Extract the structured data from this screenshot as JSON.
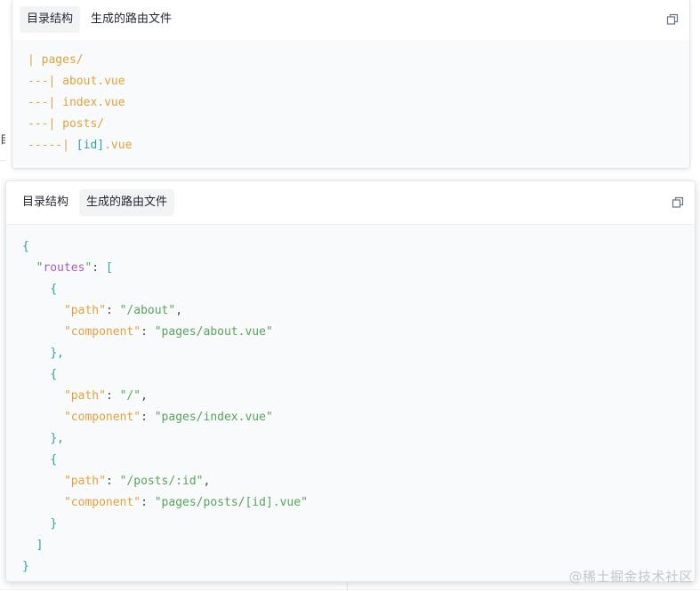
{
  "card1": {
    "tabs": [
      "目录结构",
      "生成的路由文件"
    ],
    "active_tab": 0,
    "copy_icon": "copy-icon",
    "code_lines": [
      [
        {
          "t": "| pages/",
          "c": "orange"
        }
      ],
      [
        {
          "t": "---| about.vue",
          "c": "orange"
        }
      ],
      [
        {
          "t": "---| index.vue",
          "c": "orange"
        }
      ],
      [
        {
          "t": "---| posts/",
          "c": "orange"
        }
      ],
      [
        {
          "t": "-----| ",
          "c": "orange"
        },
        {
          "t": "[id]",
          "c": "teal"
        },
        {
          "t": ".vue",
          "c": "orange"
        }
      ]
    ]
  },
  "card2": {
    "tabs": [
      "目录结构",
      "生成的路由文件"
    ],
    "active_tab": 1,
    "copy_icon": "copy-icon",
    "code_lines": [
      [
        {
          "t": "{",
          "c": "teal"
        }
      ],
      [
        {
          "t": "  ",
          "c": "dark"
        },
        {
          "t": "\"",
          "c": "green"
        },
        {
          "t": "routes",
          "c": "purple"
        },
        {
          "t": "\"",
          "c": "green"
        },
        {
          "t": ": ",
          "c": "dark"
        },
        {
          "t": "[",
          "c": "teal"
        }
      ],
      [
        {
          "t": "    ",
          "c": "dark"
        },
        {
          "t": "{",
          "c": "teal"
        }
      ],
      [
        {
          "t": "      ",
          "c": "dark"
        },
        {
          "t": "\"path\"",
          "c": "orange"
        },
        {
          "t": ": ",
          "c": "dark"
        },
        {
          "t": "\"/about\"",
          "c": "green"
        },
        {
          "t": ",",
          "c": "dark"
        }
      ],
      [
        {
          "t": "      ",
          "c": "dark"
        },
        {
          "t": "\"component\"",
          "c": "orange"
        },
        {
          "t": ": ",
          "c": "dark"
        },
        {
          "t": "\"pages/about.vue\"",
          "c": "green"
        }
      ],
      [
        {
          "t": "    ",
          "c": "dark"
        },
        {
          "t": "},",
          "c": "teal"
        }
      ],
      [
        {
          "t": "    ",
          "c": "dark"
        },
        {
          "t": "{",
          "c": "teal"
        }
      ],
      [
        {
          "t": "      ",
          "c": "dark"
        },
        {
          "t": "\"path\"",
          "c": "orange"
        },
        {
          "t": ": ",
          "c": "dark"
        },
        {
          "t": "\"/\"",
          "c": "green"
        },
        {
          "t": ",",
          "c": "dark"
        }
      ],
      [
        {
          "t": "      ",
          "c": "dark"
        },
        {
          "t": "\"component\"",
          "c": "orange"
        },
        {
          "t": ": ",
          "c": "dark"
        },
        {
          "t": "\"pages/index.vue\"",
          "c": "green"
        }
      ],
      [
        {
          "t": "    ",
          "c": "dark"
        },
        {
          "t": "},",
          "c": "teal"
        }
      ],
      [
        {
          "t": "    ",
          "c": "dark"
        },
        {
          "t": "{",
          "c": "teal"
        }
      ],
      [
        {
          "t": "      ",
          "c": "dark"
        },
        {
          "t": "\"path\"",
          "c": "orange"
        },
        {
          "t": ": ",
          "c": "dark"
        },
        {
          "t": "\"/posts/:id\"",
          "c": "green"
        },
        {
          "t": ",",
          "c": "dark"
        }
      ],
      [
        {
          "t": "      ",
          "c": "dark"
        },
        {
          "t": "\"component\"",
          "c": "orange"
        },
        {
          "t": ": ",
          "c": "dark"
        },
        {
          "t": "\"pages/posts/[id].vue\"",
          "c": "green"
        }
      ],
      [
        {
          "t": "    ",
          "c": "dark"
        },
        {
          "t": "}",
          "c": "teal"
        }
      ],
      [
        {
          "t": "  ",
          "c": "dark"
        },
        {
          "t": "]",
          "c": "teal"
        }
      ],
      [
        {
          "t": "}",
          "c": "teal"
        }
      ]
    ]
  },
  "background_fragment": "目",
  "watermark": "@稀土掘金技术社区",
  "colors": {
    "orange": "#e0a33a",
    "green": "#58a35a",
    "teal": "#2ba3a3",
    "purple": "#a85bc2",
    "tab_active_bg": "#f2f3f5",
    "code_bg": "#f8fafc"
  }
}
